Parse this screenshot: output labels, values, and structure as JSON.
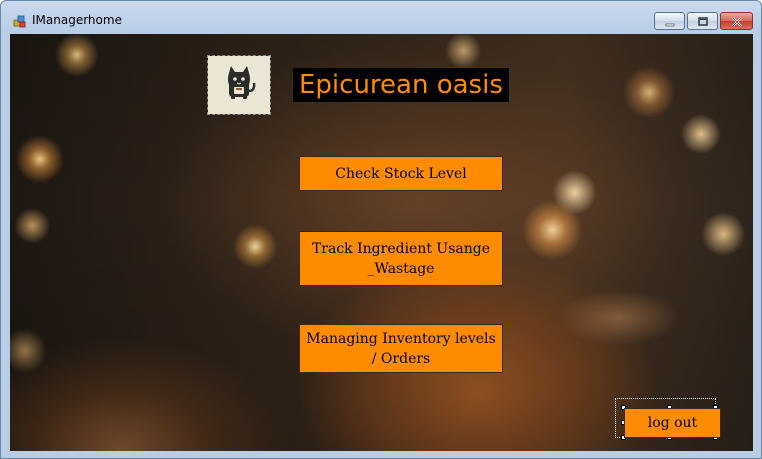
{
  "window": {
    "title": "IManagerhome"
  },
  "brand": {
    "title": "Epicurean oasis"
  },
  "menu": {
    "check_stock_label": "Check Stock Level",
    "track_ingredient_label": "Track Ingredient Usange _Wastage",
    "inventory_label": "Managing Inventory levels / Orders"
  },
  "logout": {
    "label": "log out"
  },
  "colors": {
    "accent": "#ff8c00",
    "title_background": "#000000"
  },
  "icons": {
    "app": "app-form-icon",
    "logo": "cat-mascot-icon",
    "minimize": "minimize-icon",
    "maximize": "restore-icon",
    "close": "close-icon"
  }
}
